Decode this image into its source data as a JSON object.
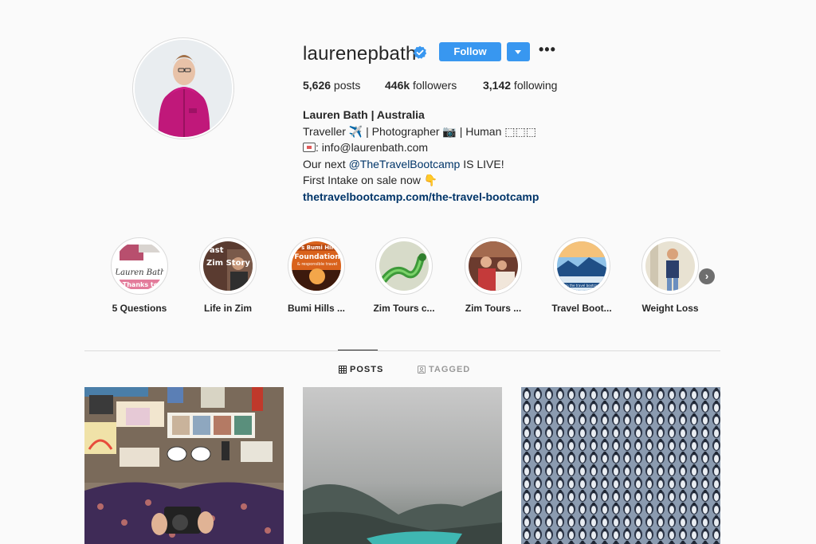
{
  "profile": {
    "username": "laurenepbath",
    "follow_label": "Follow",
    "more_label": "•••",
    "stats": {
      "posts_count": "5,626",
      "posts_label": " posts",
      "followers_count": "446k",
      "followers_label": " followers",
      "following_count": "3,142",
      "following_label": " following"
    },
    "bio": {
      "name": "Lauren Bath | Australia",
      "line1": "Traveller ✈️ | Photographer 📷 | Human ⬚⬚⬚",
      "line2_email": ": info@laurenbath.com",
      "line3_prefix": "Our next ",
      "line3_mention": "@TheTravelBootcamp",
      "line3_suffix": " IS LIVE!",
      "line4": "First Intake on sale now 👇",
      "link": "thetravelbootcamp.com/the-travel-bootcamp"
    }
  },
  "highlights": [
    {
      "label": "5 Questions"
    },
    {
      "label": "Life in Zim"
    },
    {
      "label": "Bumi Hills ..."
    },
    {
      "label": "Zim Tours c..."
    },
    {
      "label": "Zim Tours ..."
    },
    {
      "label": "Travel Boot..."
    },
    {
      "label": "Weight Loss"
    }
  ],
  "highlight_thumb_text": {
    "h1_sig": "Lauren Bath",
    "h1_thanks": "Thanks to",
    "h2_text": "Zim Story",
    "h2_top": "ast",
    "h3_top": "s Bumi Hil",
    "h3_mid": "Foundation",
    "h3_small": "& responsible travel",
    "h6_caption": "Join the travel bootcamp"
  },
  "tabs": [
    {
      "label": "POSTS",
      "active": true
    },
    {
      "label": "TAGGED",
      "active": false
    }
  ],
  "colors": {
    "accent": "#3897f0",
    "link": "#003569",
    "background": "#fafafa",
    "border": "#dbdbdb"
  },
  "icons": {
    "verified": "verified-badge-icon",
    "next": "chevron-right-icon",
    "posts_tab": "grid-icon",
    "tagged_tab": "tagged-icon"
  }
}
